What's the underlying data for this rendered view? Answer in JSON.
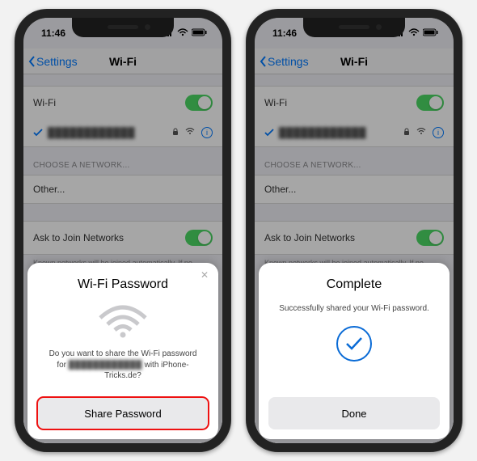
{
  "status": {
    "time": "11:46",
    "signal": "●●●●",
    "wifi": "wifi",
    "battery": "■"
  },
  "nav": {
    "back": "Settings",
    "title": "Wi-Fi"
  },
  "wifi": {
    "label": "Wi-Fi",
    "connected_network": "████████████",
    "choose_label": "CHOOSE A NETWORK...",
    "other": "Other...",
    "ask_label": "Ask to Join Networks",
    "footer": "Known networks will be joined automatically. If no known networks are available, you will be asked before joining a new network."
  },
  "sheet_share": {
    "title": "Wi-Fi Password",
    "message_pre": "Do you want to share the Wi-Fi password for",
    "network": "████████████",
    "message_post": "with iPhone-Tricks.de?",
    "button": "Share Password"
  },
  "sheet_done": {
    "title": "Complete",
    "message": "Successfully shared your Wi-Fi password.",
    "button": "Done"
  }
}
